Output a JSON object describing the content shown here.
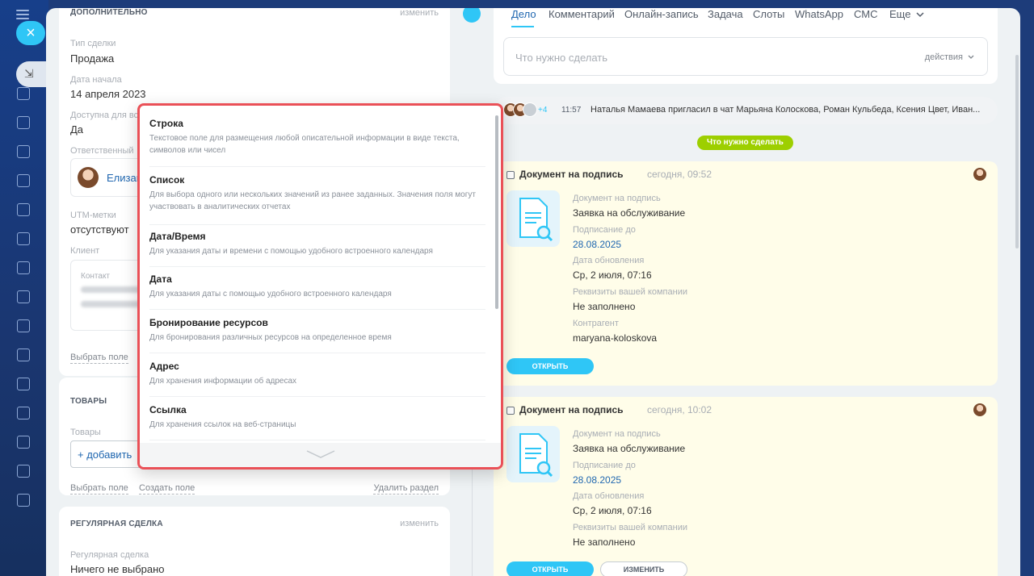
{
  "left_panel": {
    "extra_section": {
      "title": "ДОПОЛНИТЕЛЬНО",
      "edit": "изменить",
      "fields": [
        {
          "label": "Тип сделки",
          "value": "Продажа"
        },
        {
          "label": "Дата начала",
          "value": "14 апреля 2023"
        },
        {
          "label": "Доступна для все",
          "value": "Да"
        }
      ],
      "responsible_label": "Ответственный",
      "responsible_name": "Елизав",
      "utm_label": "UTM-метки",
      "utm_value": "отсутствуют",
      "client_label": "Клиент",
      "contact_label": "Контакт",
      "select_field": "Выбрать поле"
    },
    "products_section": {
      "title": "ТОВАРЫ",
      "field_label": "Товары",
      "add_button": "+ добавить",
      "select_field": "Выбрать поле",
      "create_field": "Создать поле",
      "delete_section": "Удалить раздел"
    },
    "regular_section": {
      "title": "РЕГУЛЯРНАЯ СДЕЛКА",
      "edit": "изменить",
      "field_label": "Регулярная сделка",
      "field_value": "Ничего не выбрано"
    }
  },
  "field_type_popup": {
    "items": [
      {
        "title": "Строка",
        "desc": "Текстовое поле для размещения любой описательной информации в виде текста, символов или чисел"
      },
      {
        "title": "Список",
        "desc": "Для выбора одного или нескольких значений из ранее заданных. Значения поля могут участвовать в аналитических отчетах"
      },
      {
        "title": "Дата/Время",
        "desc": "Для указания даты и времени с помощью удобного встроенного календаря"
      },
      {
        "title": "Дата",
        "desc": "Для указания даты с помощью удобного встроенного календаря"
      },
      {
        "title": "Бронирование ресурсов",
        "desc": "Для бронирования различных ресурсов на определенное время"
      },
      {
        "title": "Адрес",
        "desc": "Для хранения информации об адресах"
      },
      {
        "title": "Ссылка",
        "desc": "Для хранения ссылок на веб-страницы"
      }
    ]
  },
  "activity": {
    "tabs": [
      "Дело",
      "Комментарий",
      "Онлайн-запись",
      "Задача",
      "Слоты",
      "WhatsApp",
      "СМС",
      "Еще"
    ],
    "todo_placeholder": "Что нужно сделать",
    "todo_actions": "действия",
    "chat": {
      "plus": "+4",
      "time": "11:57",
      "text": "Наталья Мамаева пригласил в чат Марьяна Колоскова, Роман Кульбеда, Ксения Цвет, Иван..."
    },
    "divider_label": "Что нужно сделать",
    "documents": [
      {
        "title": "Документ на подпись",
        "time": "сегодня, 09:52",
        "fields": [
          {
            "label": "Документ на подпись",
            "value": "Заявка на обслуживание"
          },
          {
            "label": "Подписание до",
            "value": "28.08.2025"
          },
          {
            "label": "Дата обновления",
            "value": "Ср, 2 июля, 07:16"
          },
          {
            "label": "Реквизиты вашей компании",
            "value": "Не заполнено"
          },
          {
            "label": "Контрагент",
            "value": "maryana-koloskova"
          }
        ],
        "open_button": "ОТКРЫТЬ"
      },
      {
        "title": "Документ на подпись",
        "time": "сегодня, 10:02",
        "fields": [
          {
            "label": "Документ на подпись",
            "value": "Заявка на обслуживание"
          },
          {
            "label": "Подписание до",
            "value": "28.08.2025"
          },
          {
            "label": "Дата обновления",
            "value": "Ср, 2 июля, 07:16"
          },
          {
            "label": "Реквизиты вашей компании",
            "value": "Не заполнено"
          }
        ],
        "open_button": "ОТКРЫТЬ",
        "change_button": "ИЗМЕНИТЬ"
      }
    ]
  },
  "colors": {
    "accent": "#2fc6f6",
    "link": "#2067b0",
    "divider_badge": "#9dcf00",
    "popup_highlight": "#ea5057",
    "doc_card_bg": "#fffde9"
  },
  "icons": [
    "menu-icon",
    "close-icon",
    "document-search-icon",
    "chevron-down-icon"
  ]
}
